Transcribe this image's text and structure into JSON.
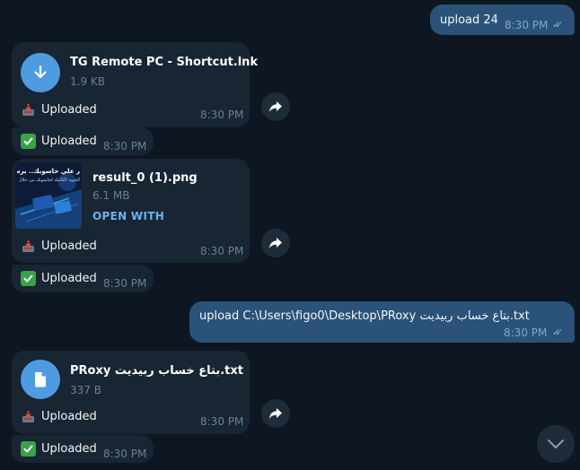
{
  "messages": {
    "m1": {
      "text": "upload 24",
      "time": "8:30 PM"
    },
    "m2": {
      "filename": "TG Remote PC - Shortcut.lnk",
      "size": "1.9 KB",
      "status": "Uploaded",
      "time": "8:30 PM"
    },
    "m3": {
      "status": "Uploaded",
      "time": "8:30 PM"
    },
    "m4": {
      "filename": "result_0 (1).png",
      "size": "6.1 MB",
      "action": "OPEN WITH",
      "status": "Uploaded",
      "time": "8:30 PM",
      "thumb_text_1": "ر علي حاسوبك.. برسالة ليك",
      "thumb_text_2": "الحوية الكاملة لحاسوبك من خلال تيليجرام"
    },
    "m5": {
      "status": "Uploaded",
      "time": "8:30 PM"
    },
    "m6": {
      "text": "upload  C:\\Users\\figo0\\Desktop\\PRoxy بتاع خساب ربيديت.txt",
      "time": "8:30 PM"
    },
    "m7": {
      "filename": "PRoxy بتاع خساب ربيديت.txt",
      "size": "337 B",
      "status": "Uploaded",
      "time": "8:30 PM"
    },
    "m8": {
      "status": "Uploaded",
      "time": "8:30 PM"
    }
  },
  "icons": {
    "download": "download-arrow-icon",
    "document": "document-icon",
    "share": "share-forward-icon",
    "tray": "inbox-tray-emoji",
    "check": "green-check-emoji",
    "read": "double-check-icon",
    "scroll": "chevron-down-icon"
  },
  "colors": {
    "background": "#0e1621",
    "incoming_bubble": "#182533",
    "outgoing_bubble": "#2b5278",
    "accent": "#4f9be0",
    "link": "#6ab3f3"
  }
}
